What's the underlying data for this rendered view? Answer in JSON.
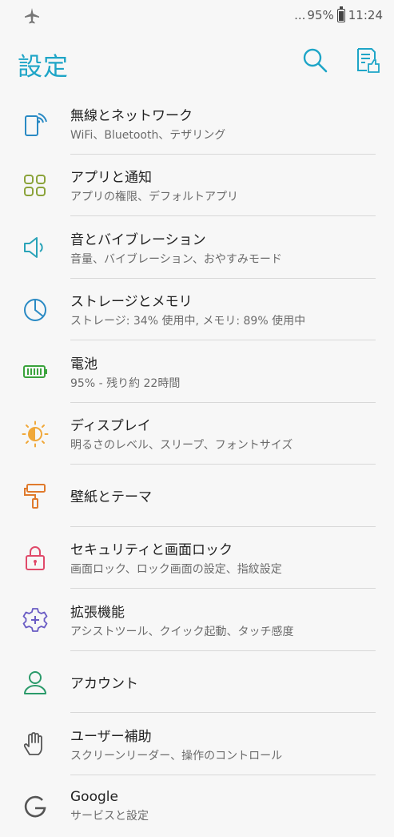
{
  "status_bar": {
    "signal_dots": "...",
    "battery_percent": "95%",
    "time": "11:24",
    "icons": [
      "airplane-mode-icon",
      "battery-icon"
    ]
  },
  "header": {
    "title": "設定",
    "icons": [
      "search-icon",
      "help-feedback-icon"
    ],
    "accent_color": "#1ea5c7"
  },
  "settings": [
    {
      "label": "無線とネットワーク",
      "summary": "WiFi、Bluetooth、テザリング",
      "icon": "wireless-icon",
      "color": "#2a8ac4"
    },
    {
      "label": "アプリと通知",
      "summary": "アプリの権限、デフォルトアプリ",
      "icon": "apps-grid-icon",
      "color": "#8ba33a"
    },
    {
      "label": "音とバイブレーション",
      "summary": "音量、バイブレーション、おやすみモード",
      "icon": "speaker-icon",
      "color": "#29a3b8"
    },
    {
      "label": "ストレージとメモリ",
      "summary": "ストレージ: 34% 使用中, メモリ: 89% 使用中",
      "icon": "storage-pie-icon",
      "color": "#2a8ac4"
    },
    {
      "label": "電池",
      "summary": "95% - 残り約 22時間",
      "icon": "battery-icon",
      "color": "#3aa33c"
    },
    {
      "label": "ディスプレイ",
      "summary": "明るさのレベル、スリープ、フォントサイズ",
      "icon": "brightness-icon",
      "color": "#f0a83a"
    },
    {
      "label": "壁紙とテーマ",
      "summary": "",
      "icon": "paint-roller-icon",
      "color": "#e07a2c"
    },
    {
      "label": "セキュリティと画面ロック",
      "summary": "画面ロック、ロック画面の設定、指紋設定",
      "icon": "lock-icon",
      "color": "#e04a6a"
    },
    {
      "label": "拡張機能",
      "summary": "アシストツール、クイック起動、タッチ感度",
      "icon": "gear-plus-icon",
      "color": "#6a5cc4"
    },
    {
      "label": "アカウント",
      "summary": "",
      "icon": "account-icon",
      "color": "#2a9a6a"
    },
    {
      "label": "ユーザー補助",
      "summary": "スクリーンリーダー、操作のコントロール",
      "icon": "hand-icon",
      "color": "#555555"
    },
    {
      "label": "Google",
      "summary": "サービスと設定",
      "icon": "google-icon",
      "color": "#555555"
    }
  ]
}
